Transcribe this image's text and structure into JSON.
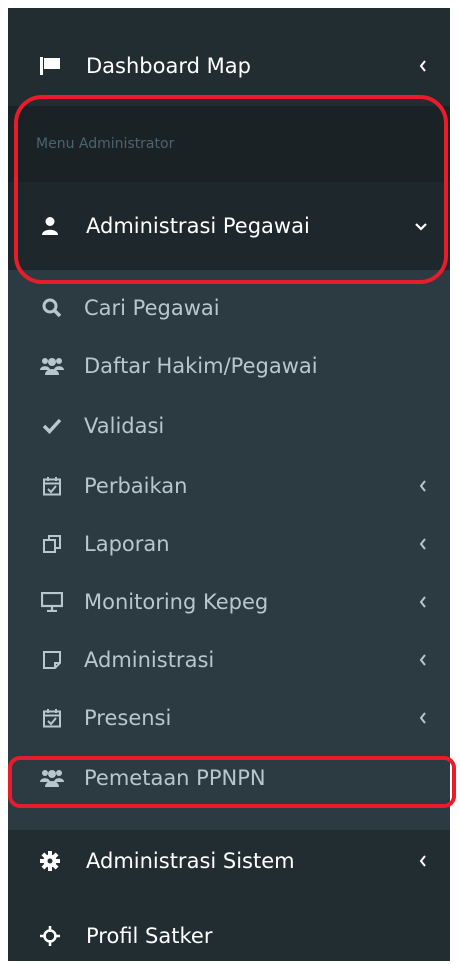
{
  "sidebar": {
    "dashboard": {
      "label": "Dashboard Map",
      "icon": "flag-icon"
    },
    "section_header": "Menu Administrator",
    "admin_pegawai": {
      "label": "Administrasi Pegawai",
      "icon": "user-icon"
    },
    "sub_items": [
      {
        "label": "Cari Pegawai",
        "icon": "search-icon"
      },
      {
        "label": "Daftar Hakim/Pegawai",
        "icon": "users-icon"
      },
      {
        "label": "Validasi",
        "icon": "check-icon"
      },
      {
        "label": "Perbaikan",
        "icon": "calendar-check-icon"
      },
      {
        "label": "Laporan",
        "icon": "copy-icon"
      },
      {
        "label": "Monitoring Kepeg",
        "icon": "monitor-icon"
      },
      {
        "label": "Administrasi",
        "icon": "sticky-note-icon"
      },
      {
        "label": "Presensi",
        "icon": "calendar-check-icon"
      },
      {
        "label": "Pemetaan PPNPN",
        "icon": "users-icon"
      }
    ],
    "admin_sistem": {
      "label": "Administrasi Sistem",
      "icon": "gear-icon"
    },
    "profil_satker": {
      "label": "Profil Satker",
      "icon": "crosshair-icon"
    }
  },
  "colors": {
    "highlight": "#e81c2a",
    "sidebar_bg": "#222d32",
    "submenu_bg": "#2c3b41"
  }
}
